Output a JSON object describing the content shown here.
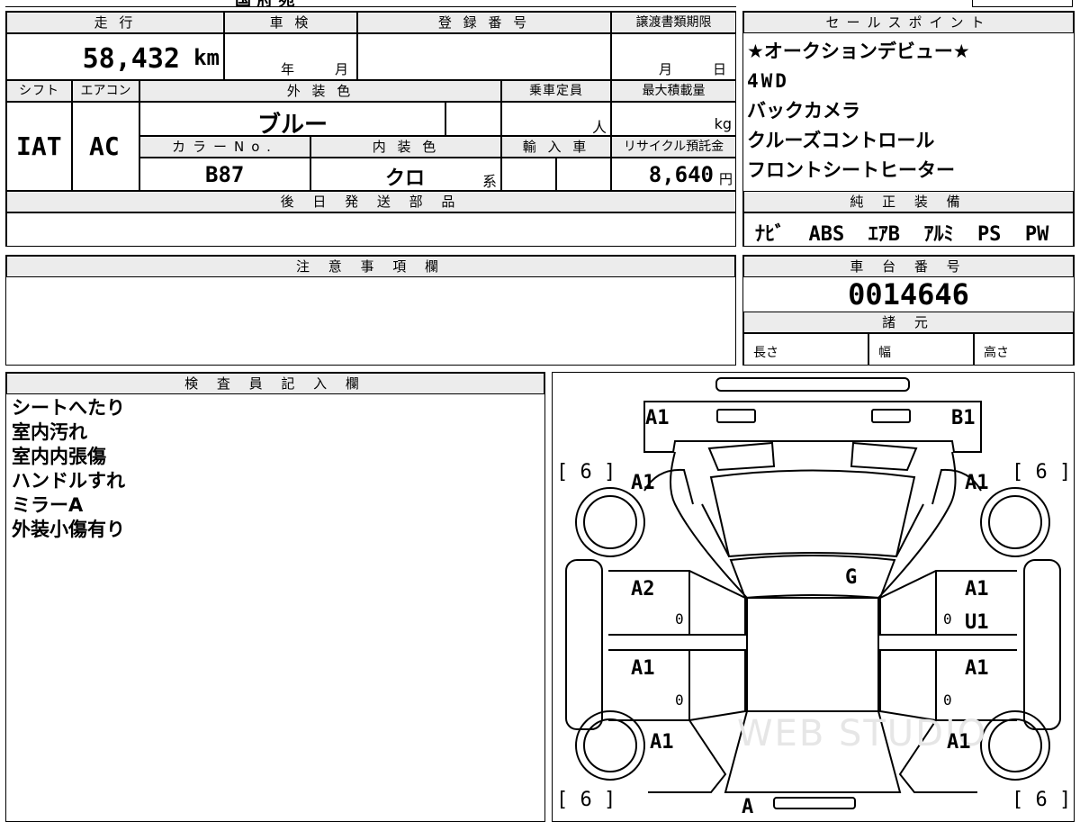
{
  "top_strip": {
    "partial_text": "国 府 苑"
  },
  "mileage": {
    "header": "走 行",
    "value": "58,432",
    "unit": "km"
  },
  "inspection": {
    "header": "車 検",
    "year_label": "年",
    "month_label": "月"
  },
  "registration": {
    "header": "登 録 番 号"
  },
  "transfer_deadline": {
    "header": "譲渡書類期限",
    "month_label": "月",
    "day_label": "日"
  },
  "sales_points": {
    "header": "セールスポイント",
    "items": [
      "★オークションデビュー★",
      "4WD",
      "バックカメラ",
      "クルーズコントロール",
      "フロントシートヒーター"
    ]
  },
  "shift": {
    "header": "シフト",
    "value": "IAT"
  },
  "aircon": {
    "header": "エアコン",
    "value": "AC"
  },
  "exterior_color": {
    "header": "外 装 色",
    "value": "ブルー"
  },
  "capacity": {
    "header": "乗車定員",
    "unit": "人"
  },
  "max_load": {
    "header": "最大積載量",
    "unit": "kg"
  },
  "color_no": {
    "header": "カラーNo.",
    "value": "B87"
  },
  "interior_color": {
    "header": "内 装 色",
    "value": "クロ",
    "suffix": "系"
  },
  "import": {
    "header": "輸 入 車"
  },
  "recycle_fee": {
    "header": "リサイクル預託金",
    "value": "8,640",
    "unit": "円"
  },
  "later_parts": {
    "header": "後 日 発 送 部 品"
  },
  "standard_equipment": {
    "header": "純 正 装 備",
    "items": "ﾅﾋﾞ  ABS  ｴｱB  ｱﾙﾐ  PS  PW"
  },
  "caution": {
    "header": "注 意 事 項 欄"
  },
  "chassis": {
    "header": "車 台 番 号",
    "value": "0014646"
  },
  "specs": {
    "header": "諸 元",
    "length_label": "長さ",
    "width_label": "幅",
    "height_label": "高さ"
  },
  "inspector": {
    "header": "検 査 員 記 入 欄",
    "notes": [
      "シートへたり",
      "室内汚れ",
      "室内内張傷",
      "ハンドルすれ",
      "ミラーA",
      "外装小傷有り"
    ]
  },
  "diagram": {
    "watermark": "WEB STUDIO",
    "tread_labels": [
      "[ 6 ]",
      "[ 6 ]",
      "[ 6 ]",
      "[ 6 ]"
    ],
    "grades": {
      "front_left": "A1",
      "front_right": "B1",
      "fender_left": "A1",
      "fender_right": "A1",
      "windshield": "G",
      "front_door_left": "A2",
      "front_door_right": "A1",
      "front_door_right_2": "U1",
      "rear_door_left": "A1",
      "rear_door_right": "A1",
      "rear_quarter_left": "A1",
      "rear_quarter_right": "A1",
      "rear": "A"
    },
    "zeros": [
      "0",
      "0",
      "0",
      "0"
    ]
  }
}
